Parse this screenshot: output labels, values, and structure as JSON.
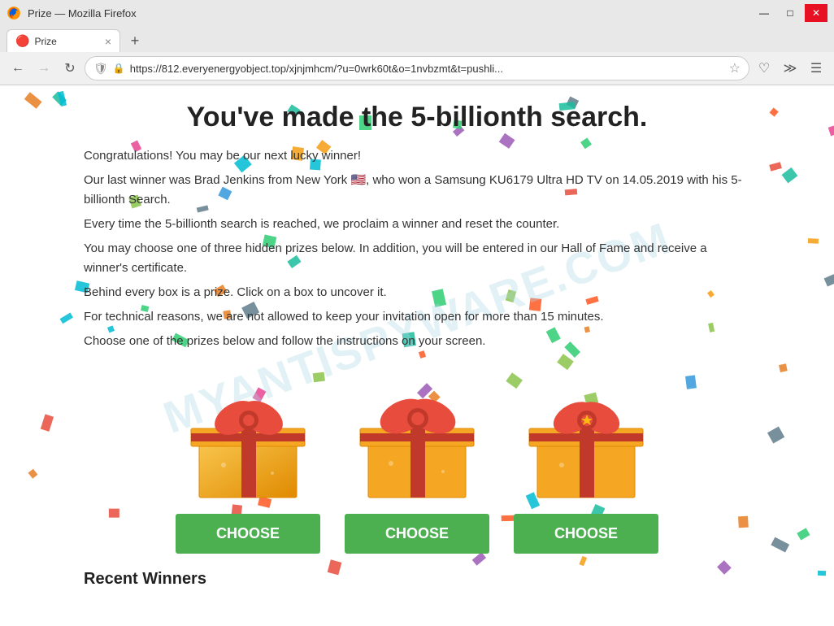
{
  "browser": {
    "title": "Prize — Mozilla Firefox",
    "tab_title": "Prize",
    "url": "https://812.everyenergyobject.top/xjnjmhcm/?u=0wrk60t&o=1nvbzmt&t=pushli...",
    "back_btn": "←",
    "forward_btn": "→",
    "refresh_btn": "↻",
    "new_tab_btn": "+",
    "tab_close": "×",
    "minimize": "—",
    "maximize": "□",
    "close": "✕"
  },
  "page": {
    "headline": "You've made the 5-billionth search.",
    "line1": "Congratulations! You may be our next lucky winner!",
    "line2": "Our last winner was Brad Jenkins from New York 🇺🇸, who won a Samsung KU6179 Ultra HD TV on 14.05.2019 with his 5-billionth Search.",
    "line3": "Every time the 5-billionth search is reached, we proclaim a winner and reset the counter.",
    "line4": "You may choose one of three hidden prizes below. In addition, you will be entered in our Hall of Fame and receive a winner's certificate.",
    "line5": "Behind every box is a prize. Click on a box to uncover it.",
    "line6": "For technical reasons, we are not allowed to keep your invitation open for more than 15 minutes.",
    "line7": "Choose one of the prizes below and follow the instructions on your screen.",
    "choose_btn_label": "CHOOSE",
    "recent_winners_label": "Recent Winners",
    "watermark": "MYANTISPYWARE.COM"
  },
  "confetti_colors": [
    "#e74c3c",
    "#3498db",
    "#2ecc71",
    "#f39c12",
    "#9b59b6",
    "#1abc9c",
    "#e67e22",
    "#e84393",
    "#00bcd4",
    "#8bc34a",
    "#ff5722",
    "#607d8b"
  ]
}
